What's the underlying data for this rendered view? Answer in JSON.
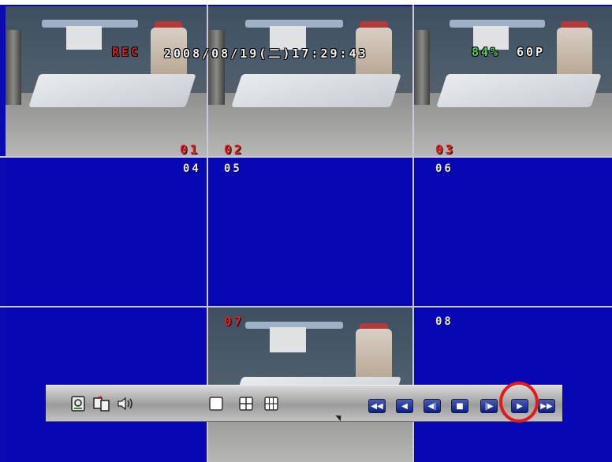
{
  "osd": {
    "rec": "REC",
    "datetime": "2008/08/19(二)17:29:43",
    "disk_usage": "84%",
    "frame_rate": "60P"
  },
  "channels": {
    "ch01": "01",
    "ch02": "02",
    "ch03": "03",
    "ch04": "04",
    "ch05": "05",
    "ch06": "06",
    "ch07": "07",
    "ch08": "08"
  },
  "toolbar": {
    "left_icons": [
      "hdd-icon",
      "channel-swap-icon",
      "speaker-icon"
    ],
    "layout_icons": [
      "single-view-icon",
      "quad-view-icon",
      "nine-view-icon"
    ],
    "playback_buttons": [
      {
        "name": "fast-rewind-button",
        "glyph": "◀◀"
      },
      {
        "name": "rewind-button",
        "glyph": "◀"
      },
      {
        "name": "step-back-button",
        "glyph": "◀|"
      },
      {
        "name": "stop-button",
        "glyph": "■"
      },
      {
        "name": "step-forward-button",
        "glyph": "|▶"
      },
      {
        "name": "play-button",
        "glyph": "▶"
      },
      {
        "name": "fast-forward-button",
        "glyph": "▶▶"
      }
    ]
  },
  "colors": {
    "screen_bg": "#0a0ab0",
    "highlight": "#e11a1a",
    "rec_text": "#d11f1f",
    "osd_yellow": "#e9d23a",
    "osd_green": "#48d05a"
  }
}
